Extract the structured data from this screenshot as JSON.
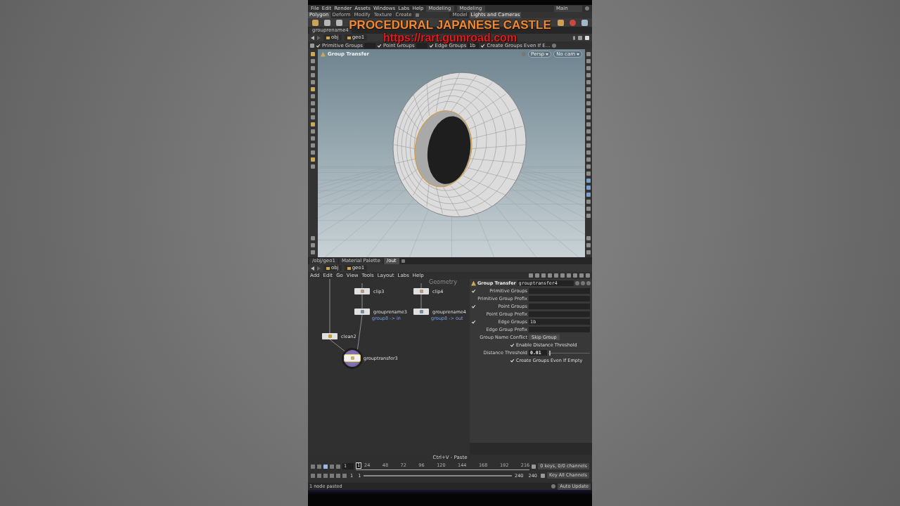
{
  "overlay": {
    "title": "PROCEDURAL JAPANESE CASTLE",
    "url": "https://rart.gumroad.com"
  },
  "menu_bar": {
    "items": [
      "File",
      "Edit",
      "Render",
      "Assets",
      "Windows",
      "Labs",
      "Help"
    ],
    "desktop": "Modeling",
    "context": "Modeling",
    "workspace": "Main"
  },
  "shelf": {
    "left_tabs": [
      {
        "label": "Polygon",
        "selected": true
      },
      {
        "label": "Deform",
        "selected": false
      },
      {
        "label": "Modify",
        "selected": false
      },
      {
        "label": "Texture",
        "selected": false
      },
      {
        "label": "Create",
        "selected": false
      }
    ],
    "right_tabs": [
      {
        "label": "Model",
        "selected": false
      },
      {
        "label": "Lights and Cameras",
        "selected": true
      }
    ]
  },
  "pane_tabs": [
    {
      "label": "grouprename4",
      "selected": false
    }
  ],
  "path": [
    "obj",
    "geo1"
  ],
  "tool_options": [
    {
      "label": "Primitive Groups",
      "checked": true
    },
    {
      "label": "Point Groups",
      "checked": true
    },
    {
      "label": "Edge Groups",
      "checked": true,
      "value": "1b"
    },
    {
      "label": "Create Groups Even If E...",
      "checked": true
    }
  ],
  "viewport": {
    "title": "Group Transfer",
    "camera": "Persp",
    "display": "No cam"
  },
  "network": {
    "tabs": [
      {
        "label": "/obj/geo1",
        "selected": false
      },
      {
        "label": "Material Palette",
        "selected": false
      },
      {
        "label": "/out",
        "selected": true
      }
    ],
    "path": [
      "obj",
      "geo1"
    ],
    "menu": [
      "Add",
      "Edit",
      "Go",
      "View",
      "Tools",
      "Layout",
      "Labs",
      "Help"
    ],
    "context_label": "Geometry",
    "nodes": [
      {
        "name": "clip3",
        "kind": "clip"
      },
      {
        "name": "clip4",
        "kind": "clip"
      },
      {
        "name": "grouprename3",
        "kind": "rename",
        "comment": "group8 -> in"
      },
      {
        "name": "grouprename4",
        "kind": "rename",
        "comment": "group8 -> out"
      },
      {
        "name": "clean2",
        "kind": "clean"
      },
      {
        "name": "grouptransfer3",
        "kind": "transfer",
        "selected": true
      }
    ]
  },
  "parameters": {
    "node_type": "Group Transfer",
    "node_name": "grouptransfer4",
    "rows": [
      {
        "kind": "field",
        "label": "Primitive Groups",
        "checked": true
      },
      {
        "kind": "field",
        "label": "Primitive Group Prefix"
      },
      {
        "kind": "field",
        "label": "Point Groups",
        "checked": true
      },
      {
        "kind": "field",
        "label": "Point Group Prefix"
      },
      {
        "kind": "field",
        "label": "Edge Groups",
        "checked": true,
        "value": "1b"
      },
      {
        "kind": "field",
        "label": "Edge Group Prefix"
      },
      {
        "kind": "menu",
        "label": "Group Name Conflict",
        "value": "Skip Group"
      },
      {
        "kind": "toggle",
        "label": "Enable Distance Threshold",
        "checked": true
      },
      {
        "kind": "slider",
        "label": "Distance Threshold",
        "value": "0.01",
        "level": 0.02
      },
      {
        "kind": "toggle",
        "label": "Create Groups Even If Empty",
        "checked": true
      }
    ]
  },
  "timeline": {
    "message": "Ctrl+V - Paste",
    "frame": "1",
    "frame_marker": "1",
    "ticks": [
      "24",
      "48",
      "72",
      "96",
      "120",
      "144",
      "168",
      "192",
      "216"
    ],
    "start": "1",
    "range_start": "1",
    "range_end": "240",
    "end": "240",
    "keys_info": "0 keys, 0/0 channels",
    "key_all": "Key All Channels"
  },
  "status_bar": {
    "message": "1 node pasted",
    "update_mode": "Auto Update"
  }
}
